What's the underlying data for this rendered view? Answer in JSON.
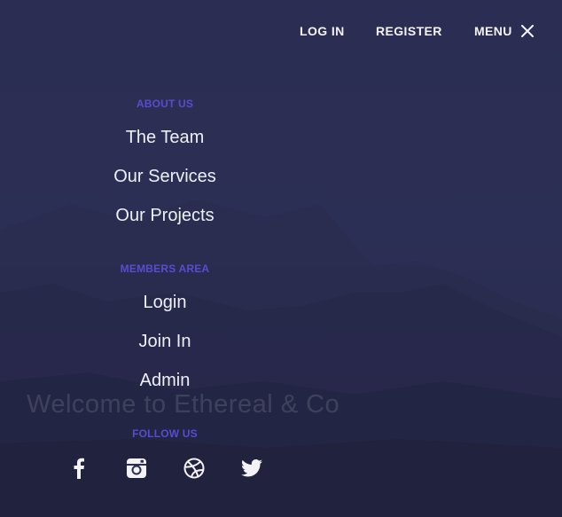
{
  "header": {
    "login_label": "LOG IN",
    "register_label": "REGISTER",
    "menu_label": "MENU"
  },
  "menu": {
    "about_heading": "ABOUT US",
    "about_items": [
      "The Team",
      "Our Services",
      "Our Projects"
    ],
    "members_heading": "MEMBERS AREA",
    "members_items": [
      "Login",
      "Join In",
      "Admin"
    ],
    "follow_heading": "FOLLOW US",
    "social_icons": [
      "facebook-icon",
      "instagram-icon",
      "dribbble-icon",
      "twitter-icon"
    ]
  },
  "hero": {
    "title": "Welcome to Ethereal & Co"
  },
  "colors": {
    "accent": "#5a4bd0",
    "background": "#2b2d52",
    "text": "#eef0f8"
  }
}
